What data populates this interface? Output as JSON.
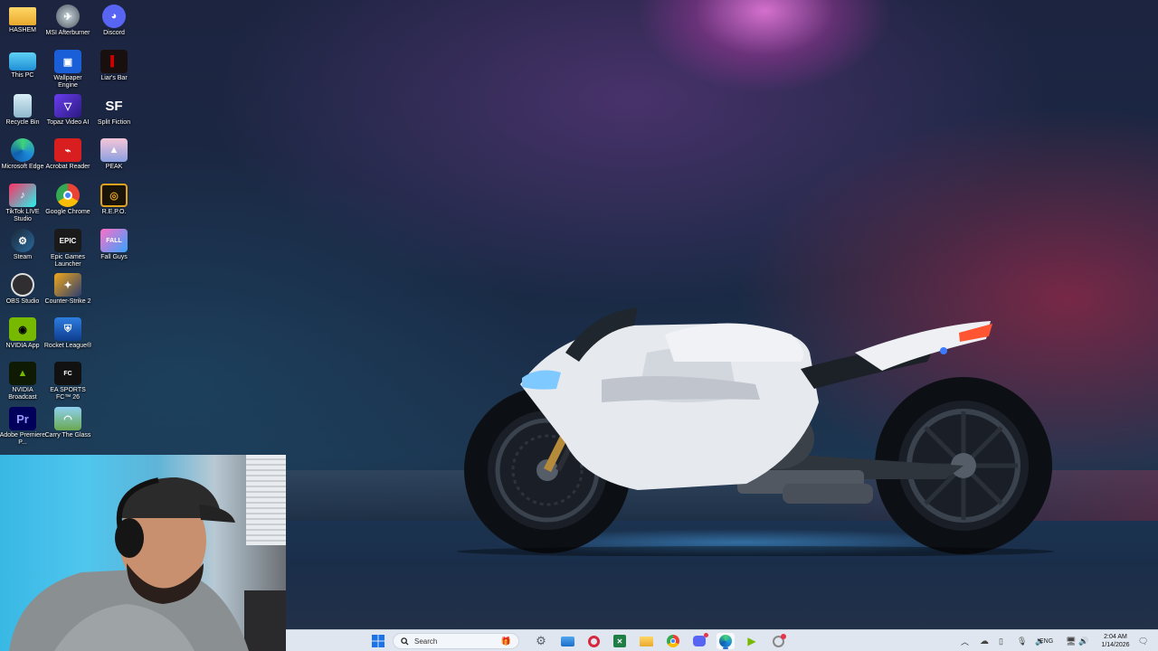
{
  "desktop": {
    "icons": [
      {
        "label": "HASHEM",
        "icon": "folder-icon"
      },
      {
        "label": "MSI Afterburner",
        "icon": "msi-afterburner-icon"
      },
      {
        "label": "Discord",
        "icon": "discord-icon"
      },
      {
        "label": "This PC",
        "icon": "this-pc-icon"
      },
      {
        "label": "Wallpaper Engine",
        "icon": "wallpaper-engine-icon"
      },
      {
        "label": "Liar's Bar",
        "icon": "liars-bar-icon"
      },
      {
        "label": "Recycle Bin",
        "icon": "recycle-bin-icon"
      },
      {
        "label": "Topaz Video AI",
        "icon": "topaz-video-ai-icon"
      },
      {
        "label": "Split Fiction",
        "icon": "split-fiction-icon",
        "glyph": "SF"
      },
      {
        "label": "Microsoft Edge",
        "icon": "edge-icon"
      },
      {
        "label": "Acrobat Reader",
        "icon": "acrobat-reader-icon"
      },
      {
        "label": "PEAK",
        "icon": "peak-icon"
      },
      {
        "label": "TikTok LIVE Studio",
        "icon": "tiktok-live-studio-icon"
      },
      {
        "label": "Google Chrome",
        "icon": "chrome-icon"
      },
      {
        "label": "R.E.P.O.",
        "icon": "repo-icon"
      },
      {
        "label": "Steam",
        "icon": "steam-icon"
      },
      {
        "label": "Epic Games Launcher",
        "icon": "epic-games-icon",
        "glyph": "EPIC"
      },
      {
        "label": "Fall Guys",
        "icon": "fall-guys-icon"
      },
      {
        "label": "OBS Studio",
        "icon": "obs-studio-icon"
      },
      {
        "label": "Counter-Strike 2",
        "icon": "counter-strike-icon"
      },
      {
        "label": "NVIDIA App",
        "icon": "nvidia-app-icon"
      },
      {
        "label": "Rocket League®",
        "icon": "rocket-league-icon"
      },
      {
        "label": "NVIDIA Broadcast",
        "icon": "nvidia-broadcast-icon"
      },
      {
        "label": "EA SPORTS FC™ 26",
        "icon": "ea-sports-fc-icon"
      },
      {
        "label": "Adobe Premiere P...",
        "icon": "premiere-pro-icon",
        "glyph": "Pr"
      },
      {
        "label": "Carry The Glass",
        "icon": "carry-the-glass-icon"
      }
    ]
  },
  "taskbar": {
    "search_placeholder": "Search",
    "apps": [
      {
        "name": "start-button",
        "icon": "windows-start-icon"
      },
      {
        "name": "search-box",
        "icon": "search-icon"
      },
      {
        "name": "settings",
        "icon": "gear-icon"
      },
      {
        "name": "photos",
        "icon": "photos-icon"
      },
      {
        "name": "app-red",
        "icon": "red-circle-app-icon"
      },
      {
        "name": "excel",
        "icon": "excel-icon"
      },
      {
        "name": "file-explorer",
        "icon": "folder-icon"
      },
      {
        "name": "chrome",
        "icon": "chrome-icon"
      },
      {
        "name": "discord",
        "icon": "discord-icon"
      },
      {
        "name": "edge",
        "icon": "edge-icon"
      },
      {
        "name": "nvidia-broadcast",
        "icon": "nvidia-broadcast-icon"
      },
      {
        "name": "snipping-tool",
        "icon": "snipping-tool-icon"
      }
    ],
    "tray": {
      "language": "ENG",
      "time": "2:04 AM",
      "date": "1/14/2026"
    }
  },
  "colors": {
    "taskbar_bg": "#dfe6ef",
    "accent": "#2b6fd6",
    "discord": "#5865f2",
    "nvidia": "#76b900"
  }
}
